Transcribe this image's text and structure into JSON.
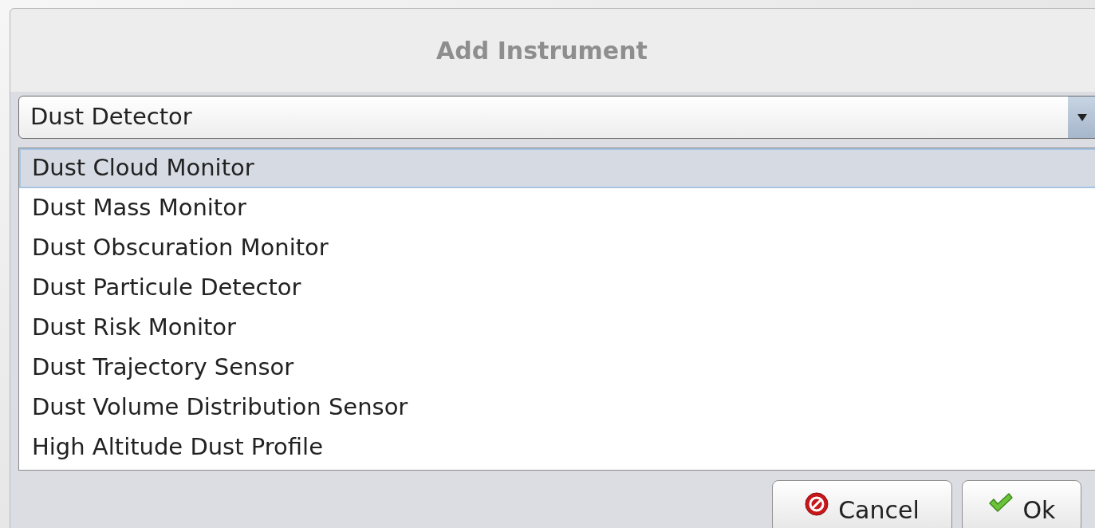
{
  "dialog": {
    "title": "Add Instrument"
  },
  "category_select": {
    "value": "Dust Detector"
  },
  "instruments": [
    {
      "label": "Dust Cloud Monitor",
      "selected": true
    },
    {
      "label": "Dust Mass Monitor",
      "selected": false
    },
    {
      "label": "Dust Obscuration Monitor",
      "selected": false
    },
    {
      "label": "Dust Particule Detector",
      "selected": false
    },
    {
      "label": "Dust Risk Monitor",
      "selected": false
    },
    {
      "label": "Dust Trajectory Sensor",
      "selected": false
    },
    {
      "label": "Dust Volume Distribution Sensor",
      "selected": false
    },
    {
      "label": "High Altitude Dust Profile",
      "selected": false
    }
  ],
  "buttons": [
    {
      "label": "Cancel",
      "kind": "cancel"
    },
    {
      "label": "Ok",
      "kind": "ok"
    }
  ]
}
